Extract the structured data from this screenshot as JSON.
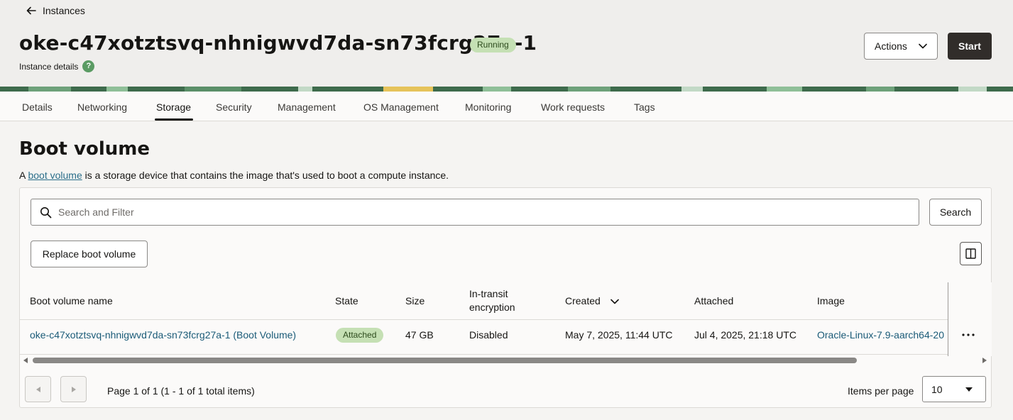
{
  "header": {
    "back_label": "Instances",
    "title": "oke-c47xotztsvq-nhnigwvd7da-sn73fcrg27a-1",
    "status": "Running",
    "subtitle": "Instance details",
    "help_glyph": "?",
    "actions_label": "Actions",
    "start_label": "Start"
  },
  "tabs": [
    "Details",
    "Networking",
    "Storage",
    "Security",
    "Management",
    "OS Management",
    "Monitoring",
    "Work requests",
    "Tags"
  ],
  "active_tab": "Storage",
  "section": {
    "title": "Boot volume",
    "desc_prefix": "A ",
    "desc_link": "boot volume",
    "desc_suffix": " is a storage device that contains the image that's used to boot a compute instance."
  },
  "toolbar": {
    "search_placeholder": "Search and Filter",
    "search_label": "Search",
    "replace_label": "Replace boot volume"
  },
  "table": {
    "columns": [
      "Boot volume name",
      "State",
      "Size",
      "In-transit encryption",
      "Created",
      "Attached",
      "Image"
    ],
    "rows": [
      {
        "name": "oke-c47xotztsvq-nhnigwvd7da-sn73fcrg27a-1 (Boot Volume)",
        "state": "Attached",
        "size": "47 GB",
        "encryption": "Disabled",
        "created": "May 7, 2025, 11:44 UTC",
        "attached": "Jul 4, 2025, 21:18 UTC",
        "image": "Oracle-Linux-7.9-aarch64-20"
      }
    ]
  },
  "pagination": {
    "summary": "Page 1 of 1 (1 - 1 of 1 total items)",
    "per_page_label": "Items per page",
    "per_page_value": "10"
  },
  "colors": {
    "status_bg": "#c5e0b4",
    "link": "#1a5b78",
    "primary_button": "#312d2a"
  }
}
